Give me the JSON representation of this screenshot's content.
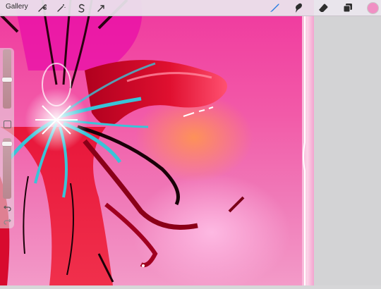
{
  "toolbar": {
    "gallery_label": "Gallery",
    "left_tools": [
      "wrench-icon",
      "magic-wand-icon",
      "selection-s-icon",
      "transform-arrow-icon"
    ],
    "right_tools": [
      "brush-icon",
      "smudge-icon",
      "eraser-icon",
      "layers-icon"
    ],
    "active_tool": "brush-icon",
    "accent_color": "#2a7de1",
    "current_color": "#f090c4"
  },
  "sidebar": {
    "brush_size_level": 0.6,
    "opacity_level": 0.95
  },
  "colors": {
    "canvas_primary": "#f0389e",
    "panel_background": "#d3d3d5"
  }
}
